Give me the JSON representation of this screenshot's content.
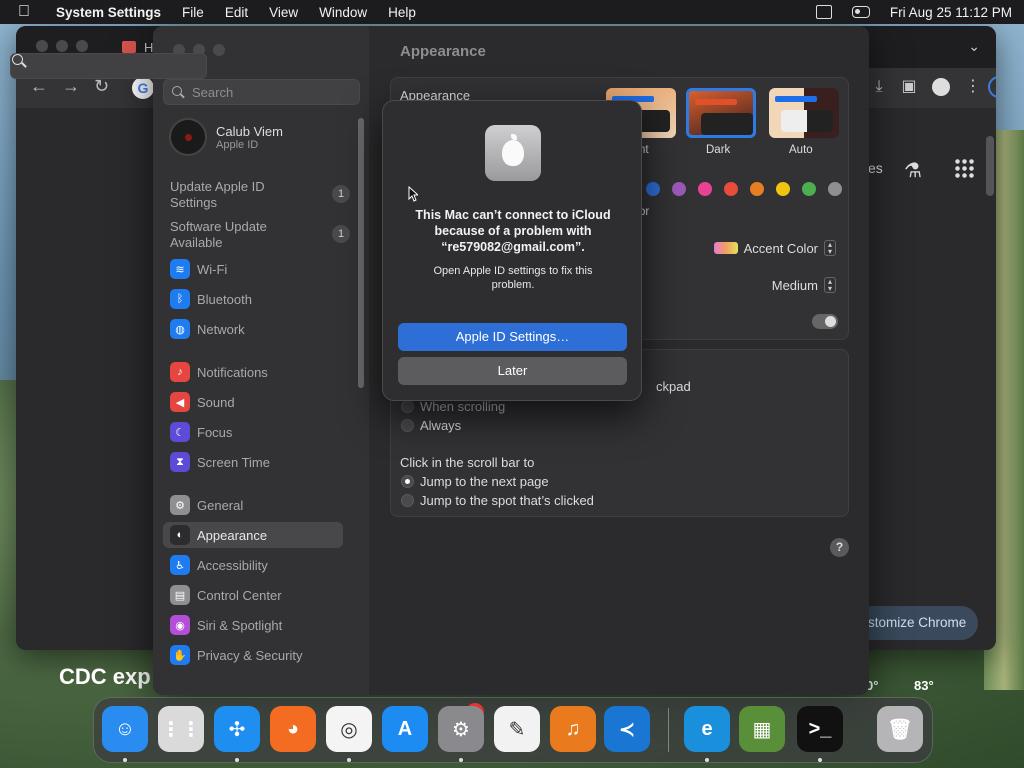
{
  "menubar": {
    "app_name": "System Settings",
    "items": [
      "File",
      "Edit",
      "View",
      "Window",
      "Help"
    ],
    "datetime": "Fri Aug 25  11:12 PM"
  },
  "chrome": {
    "tab_title": "H",
    "right_text": "es",
    "customize_label": "stomize Chrome"
  },
  "settings": {
    "search_placeholder": "Search",
    "user": {
      "name": "Calub Viem",
      "sub": "Apple ID"
    },
    "alerts": [
      {
        "label": "Update Apple ID Settings",
        "count": "1"
      },
      {
        "label": "Software Update Available",
        "count": "1"
      }
    ],
    "sidebar_items": [
      {
        "label": "Wi-Fi",
        "icon": "wifi-icon",
        "color": "#1e7cf0",
        "glyph": "≋"
      },
      {
        "label": "Bluetooth",
        "icon": "bluetooth-icon",
        "color": "#1e7cf0",
        "glyph": "ᛒ"
      },
      {
        "label": "Network",
        "icon": "globe-icon",
        "color": "#1e7cf0",
        "glyph": "◍"
      },
      {
        "label": "Notifications",
        "icon": "bell-icon",
        "color": "#e5463f",
        "glyph": "♪"
      },
      {
        "label": "Sound",
        "icon": "speaker-icon",
        "color": "#e5463f",
        "glyph": "◀"
      },
      {
        "label": "Focus",
        "icon": "moon-icon",
        "color": "#5b4bd6",
        "glyph": "☾"
      },
      {
        "label": "Screen Time",
        "icon": "hourglass-icon",
        "color": "#5b4bd6",
        "glyph": "⧗"
      },
      {
        "label": "General",
        "icon": "gear-icon",
        "color": "#8e8e93",
        "glyph": "⚙"
      },
      {
        "label": "Appearance",
        "icon": "appearance-icon",
        "color": "#2c2c2e",
        "glyph": "◐"
      },
      {
        "label": "Accessibility",
        "icon": "accessibility-icon",
        "color": "#1e7cf0",
        "glyph": "♿"
      },
      {
        "label": "Control Center",
        "icon": "control-center-icon",
        "color": "#8e8e93",
        "glyph": "▤"
      },
      {
        "label": "Siri & Spotlight",
        "icon": "siri-icon",
        "color": "#b34fd6",
        "glyph": "◉"
      },
      {
        "label": "Privacy & Security",
        "icon": "hand-icon",
        "color": "#1e7cf0",
        "glyph": "✋"
      }
    ],
    "main": {
      "title": "Appearance",
      "appearance_label": "Appearance",
      "modes": [
        "nt",
        "Dark",
        "Auto"
      ],
      "accent_fragment": "or",
      "accent_colors": [
        "#2d6fd6",
        "#9b59b6",
        "#e84393",
        "#e74c3c",
        "#e67e22",
        "#f1c40f",
        "#4cae4f",
        "#8e8e93"
      ],
      "accent_color_value": "Accent Color",
      "sidebar_icon_size": "Medium",
      "scroll_fragment": "ckpad",
      "scroll_options": [
        "When scrolling",
        "Always"
      ],
      "click_title": "Click in the scroll bar to",
      "click_options": [
        "Jump to the next page",
        "Jump to the spot that’s clicked"
      ],
      "help": "?"
    }
  },
  "dialog": {
    "title": "This Mac can’t connect to iCloud because of a problem with “re579082@gmail.com”.",
    "message": "Open Apple ID settings to fix this problem.",
    "primary": "Apple ID Settings…",
    "secondary": "Later"
  },
  "desktop": {
    "headline": "CDC exp",
    "temps": [
      "0°",
      "83°"
    ]
  },
  "dock": {
    "badge": "2",
    "apps": [
      {
        "name": "finder",
        "color": "#2a8cf0",
        "glyph": "☺"
      },
      {
        "name": "launchpad",
        "color": "#dadada",
        "glyph": "⋮⋮"
      },
      {
        "name": "safari",
        "color": "#1e8ef0",
        "glyph": "✣"
      },
      {
        "name": "firefox",
        "color": "#f36c22",
        "glyph": "◕"
      },
      {
        "name": "chrome",
        "color": "#f4f4f4",
        "glyph": "◎"
      },
      {
        "name": "app-store",
        "color": "#1c8cf3",
        "glyph": "A"
      },
      {
        "name": "system-settings",
        "color": "#8a8a8e",
        "glyph": "⚙"
      },
      {
        "name": "textedit",
        "color": "#f2f2f2",
        "glyph": "✎"
      },
      {
        "name": "garageband",
        "color": "#e97a1e",
        "glyph": "♫"
      },
      {
        "name": "vscode",
        "color": "#1976d2",
        "glyph": "≺"
      },
      {
        "name": "edge",
        "color": "#1a8fdc",
        "glyph": "e"
      },
      {
        "name": "minecraft",
        "color": "#5a8f3a",
        "glyph": "▦"
      },
      {
        "name": "terminal",
        "color": "#111",
        "glyph": ">_"
      },
      {
        "name": "trash",
        "color": "#b5b5b8",
        "glyph": "🗑"
      }
    ]
  }
}
